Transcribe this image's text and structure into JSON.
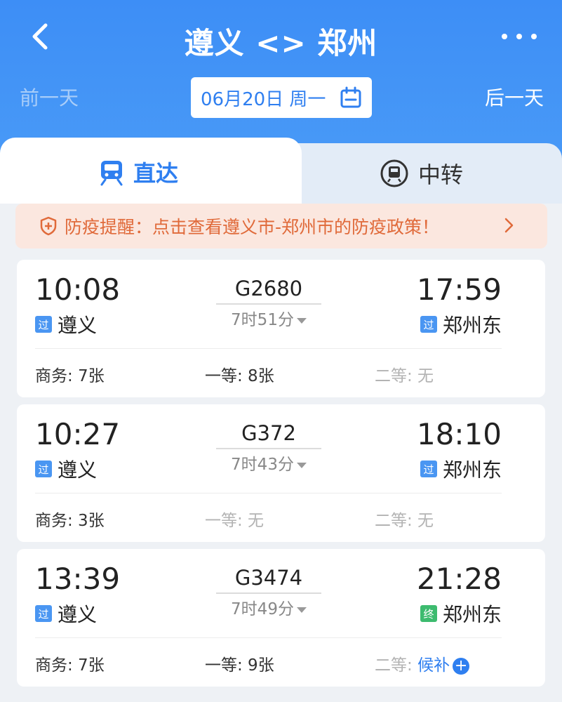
{
  "header": {
    "title": "遵义 <> 郑州",
    "prev_day": "前一天",
    "next_day": "后一天",
    "date": "06月20日 周一",
    "colors": {
      "primary": "#3d8ef6",
      "accent": "#2f7ff0"
    }
  },
  "tabs": {
    "direct": "直达",
    "transfer": "中转"
  },
  "notice": {
    "text": "防疫提醒：点击查看遵义市-郑州市的防疫政策！"
  },
  "trains": [
    {
      "dep_time": "10:08",
      "dep_station": "遵义",
      "dep_badge": "过",
      "train_no": "G2680",
      "duration": "7时51分",
      "arr_time": "17:59",
      "arr_station": "郑州东",
      "arr_badge": "过",
      "seats": [
        {
          "label": "商务: 7张"
        },
        {
          "label": "一等: 8张"
        },
        {
          "label": "二等: 无"
        }
      ]
    },
    {
      "dep_time": "10:27",
      "dep_station": "遵义",
      "dep_badge": "过",
      "train_no": "G372",
      "duration": "7时43分",
      "arr_time": "18:10",
      "arr_station": "郑州东",
      "arr_badge": "过",
      "seats": [
        {
          "label": "商务: 3张"
        },
        {
          "label": "一等: 无"
        },
        {
          "label": "二等: 无"
        }
      ]
    },
    {
      "dep_time": "13:39",
      "dep_station": "遵义",
      "dep_badge": "过",
      "train_no": "G3474",
      "duration": "7时49分",
      "arr_time": "21:28",
      "arr_station": "郑州东",
      "arr_badge": "终",
      "seats": [
        {
          "label": "商务: 7张"
        },
        {
          "label": "一等: 9张"
        },
        {
          "label": "二等: ",
          "wait": "候补"
        }
      ]
    }
  ]
}
